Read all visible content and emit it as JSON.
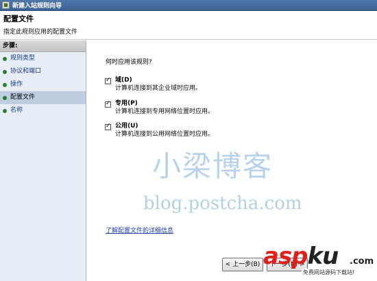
{
  "window": {
    "title": "新建入站规则向导"
  },
  "header": {
    "title": "配置文件",
    "subtitle": "指定此规则应用的配置文件"
  },
  "sidebar": {
    "heading": "步骤:",
    "items": [
      {
        "label": "规则类型"
      },
      {
        "label": "协议和端口"
      },
      {
        "label": "操作"
      },
      {
        "label": "配置文件",
        "active": true
      },
      {
        "label": "名称"
      }
    ]
  },
  "main": {
    "question": "何时应用该规则?",
    "options": [
      {
        "label": "域(D)",
        "desc": "计算机连接到其企业域时应用。",
        "checked": true
      },
      {
        "label": "专用(P)",
        "desc": "计算机连接到专用网络位置时应用。",
        "checked": true
      },
      {
        "label": "公用(U)",
        "desc": "计算机连接到公用网络位置时应用。",
        "checked": true
      }
    ],
    "link": "了解配置文件的详细信息"
  },
  "buttons": {
    "back": "< 上一步(B)",
    "next": "下一步(N) >"
  },
  "watermark": {
    "line1": "小梁博客",
    "line2": "blog.postcha.com"
  },
  "logo": {
    "word_a": "asp",
    "word_b": "ku",
    "suffix": ".com",
    "tagline": "免费网站源码下载站!"
  },
  "colors": {
    "accent_link": "#1b3fa8",
    "step_bullet": "#2f7d2f",
    "logo_red": "#e0201a"
  }
}
